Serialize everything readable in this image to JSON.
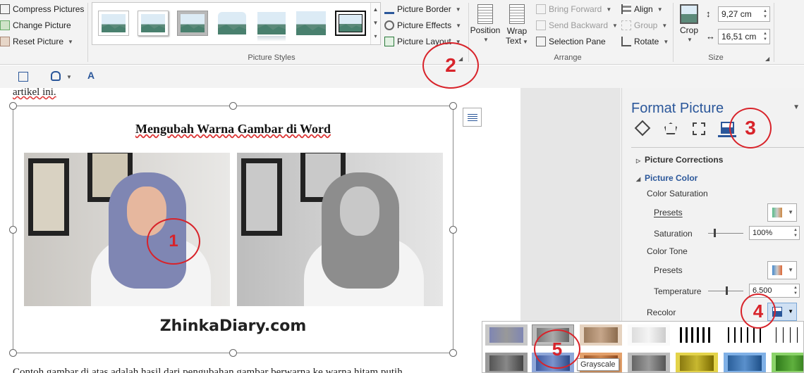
{
  "ribbon": {
    "adjust": {
      "compress": "Compress Pictures",
      "change": "Change Picture",
      "reset": "Reset Picture"
    },
    "picture_styles": {
      "border": "Picture Border",
      "effects": "Picture Effects",
      "layout": "Picture Layout",
      "group_label": "Picture Styles"
    },
    "arrange": {
      "position": "Position",
      "wrap_text_line1": "Wrap",
      "wrap_text_line2": "Text",
      "bring_forward": "Bring Forward",
      "send_backward": "Send Backward",
      "selection_pane": "Selection Pane",
      "align": "Align",
      "group": "Group",
      "rotate": "Rotate",
      "group_label": "Arrange"
    },
    "size": {
      "crop": "Crop",
      "height": "9,27 cm",
      "width": "16,51 cm",
      "group_label": "Size"
    }
  },
  "document": {
    "top_text": "artikel ini.",
    "picture_title": "Mengubah Warna Gambar di Word",
    "watermark": "ZhinkaDiary.com",
    "bottom_text": "Contoh gambar di atas adalah hasil dari pengubahan gambar berwarna ke warna hitam putih"
  },
  "pane": {
    "title": "Format Picture",
    "tabs": [
      "fill-line-icon",
      "effects-icon",
      "layout-size-icon",
      "picture-icon"
    ],
    "picture_corrections": "Picture Corrections",
    "picture_color": "Picture Color",
    "color_saturation": "Color Saturation",
    "presets_1": "Presets",
    "saturation_label": "Saturation",
    "saturation_value": "100%",
    "saturation_level": 0.15,
    "color_tone": "Color Tone",
    "presets_2": "Presets",
    "temperature_label": "Temperature",
    "temperature_value": "6.500",
    "temperature_level": 0.5,
    "recolor": "Recolor"
  },
  "recolor_popup": {
    "tooltip": "Grayscale"
  },
  "annotations": [
    "1",
    "2",
    "3",
    "4",
    "5"
  ],
  "colors": {
    "accent": "#2b579a",
    "annotation_red": "#d8232a"
  }
}
